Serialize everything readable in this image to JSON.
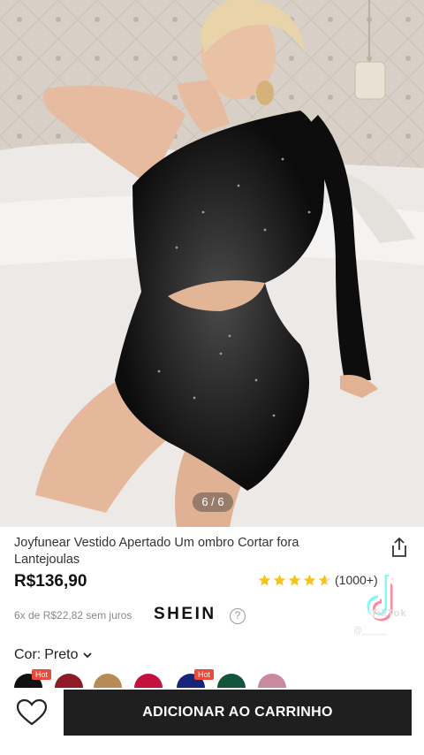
{
  "gallery": {
    "counter": "6 / 6"
  },
  "product": {
    "title": "Joyfunear Vestido Apertado Um ombro Cortar fora Lantejoulas",
    "price": "R$136,90",
    "rating": {
      "stars": 4.5,
      "count": "(1000+)"
    },
    "installments": "6x de R$22,82 sem juros",
    "brand": "SHEIN",
    "color_label": "Cor:",
    "color_value": "Preto"
  },
  "swatches": [
    {
      "color": "#111111",
      "hot": "Hot"
    },
    {
      "color": "#8e1b26"
    },
    {
      "color": "#b88a54"
    },
    {
      "color": "#c3123f"
    },
    {
      "color": "#16257a",
      "hot": "Hot"
    },
    {
      "color": "#12553a"
    },
    {
      "color": "#c98aa0"
    }
  ],
  "watermark": {
    "app": "TikTok",
    "user": "@_____"
  },
  "actions": {
    "add_to_cart": "ADICIONAR AO CARRINHO"
  },
  "colors": {
    "primary_button": "#1f1f1f",
    "star": "#f7c21a"
  }
}
